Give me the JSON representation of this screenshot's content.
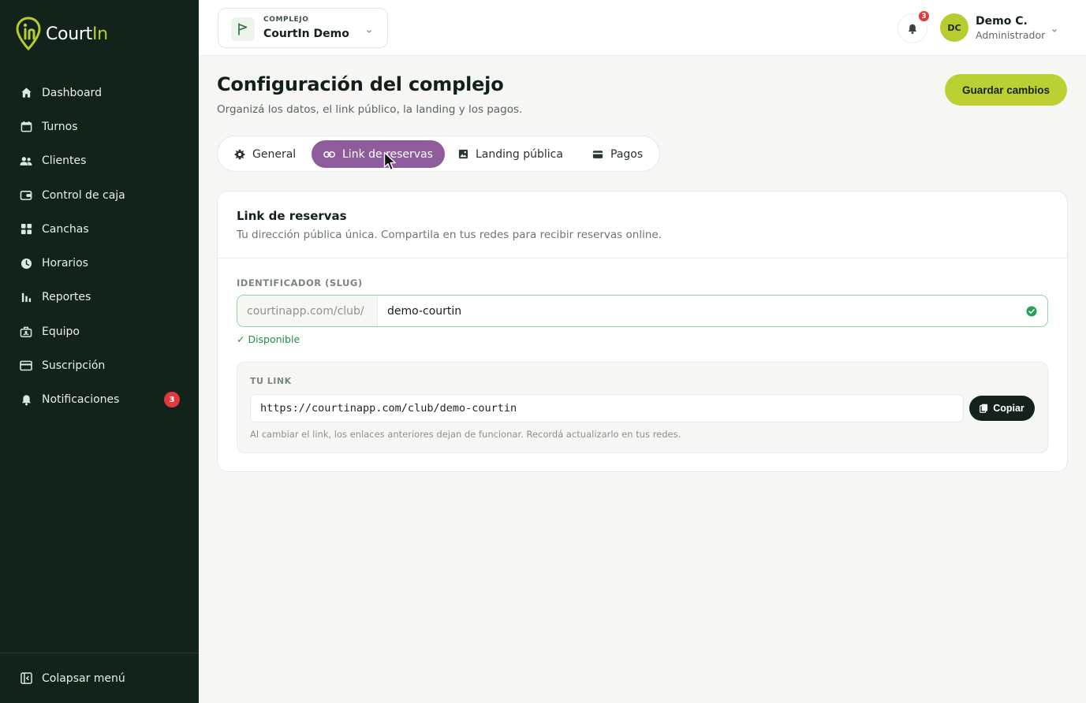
{
  "brand": {
    "name_part1": "Court",
    "name_part2": "In"
  },
  "sidebar": {
    "items": [
      {
        "label": "Dashboard",
        "icon": "home-icon"
      },
      {
        "label": "Turnos",
        "icon": "calendar-icon"
      },
      {
        "label": "Clientes",
        "icon": "users-icon"
      },
      {
        "label": "Control de caja",
        "icon": "wallet-icon"
      },
      {
        "label": "Canchas",
        "icon": "grid-icon"
      },
      {
        "label": "Horarios",
        "icon": "clock-icon"
      },
      {
        "label": "Reportes",
        "icon": "bar-chart-icon"
      },
      {
        "label": "Equipo",
        "icon": "team-icon"
      },
      {
        "label": "Suscripción",
        "icon": "card-icon"
      },
      {
        "label": "Notificaciones",
        "icon": "bell-icon",
        "badge": "3"
      }
    ],
    "collapse_label": "Colapsar menú"
  },
  "topbar": {
    "complex_label": "COMPLEJO",
    "complex_name": "CourtIn Demo",
    "notif_count": "3",
    "user_initials": "DC",
    "user_name": "Demo C.",
    "user_role": "Administrador"
  },
  "page": {
    "title": "Configuración del complejo",
    "subtitle": "Organizá los datos, el link público, la landing y los pagos.",
    "save_label": "Guardar cambios"
  },
  "tabs": [
    {
      "label": "General",
      "icon": "gear-icon"
    },
    {
      "label": "Link de reservas",
      "icon": "link-icon",
      "active": true
    },
    {
      "label": "Landing pública",
      "icon": "image-icon"
    },
    {
      "label": "Pagos",
      "icon": "credit-card-icon"
    }
  ],
  "card": {
    "title": "Link de reservas",
    "description": "Tu dirección pública única. Compartila en tus redes para recibir reservas online.",
    "slug_label": "IDENTIFICADOR (SLUG)",
    "slug_prefix": "courtinapp.com/club/",
    "slug_value": "demo-courtin",
    "availability": "✓ Disponible",
    "link_label": "TU LINK",
    "link_url": "https://courtinapp.com/club/demo-courtin",
    "copy_label": "Copiar",
    "note": "Al cambiar el link, los enlaces anteriores dejan de funcionar. Recordá actualizarlo en tus redes."
  },
  "colors": {
    "sidebar_bg": "#12231b",
    "accent_lime": "#bcd033",
    "tab_active": "#8e5c9d",
    "success_green": "#1f8f4a",
    "badge_red": "#e03b3b"
  }
}
